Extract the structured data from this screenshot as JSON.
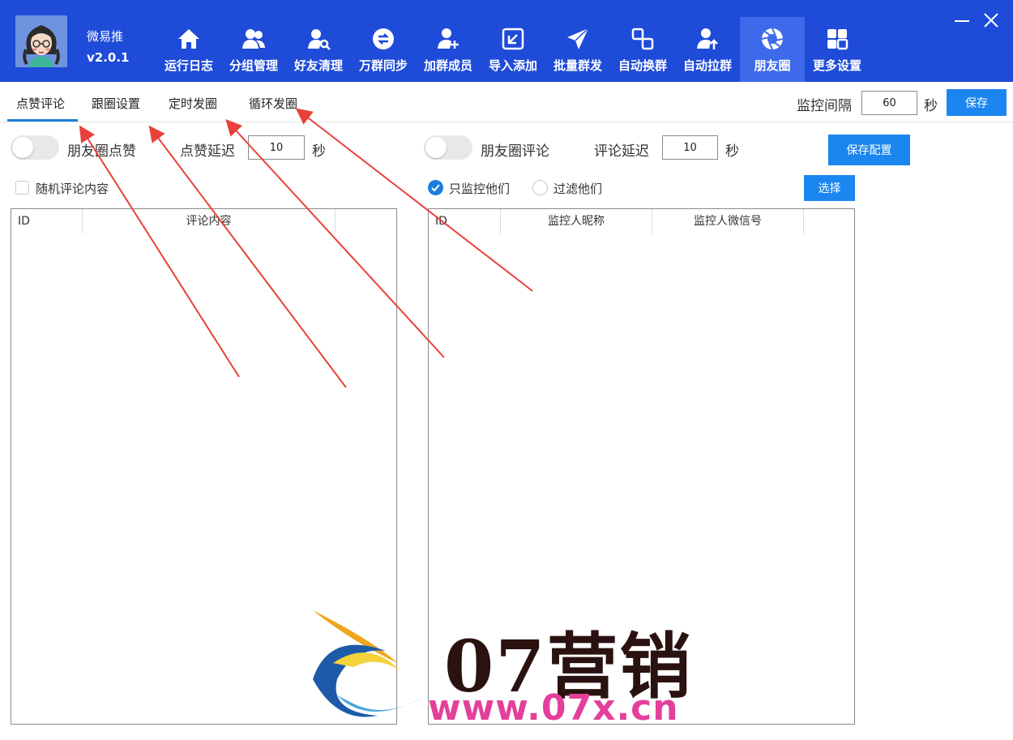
{
  "app": {
    "name": "微易推",
    "version": "v2.0.1"
  },
  "nav": [
    {
      "label": "运行日志",
      "icon": "home-icon"
    },
    {
      "label": "分组管理",
      "icon": "users-icon"
    },
    {
      "label": "好友清理",
      "icon": "user-search-icon"
    },
    {
      "label": "万群同步",
      "icon": "sync-icon"
    },
    {
      "label": "加群成员",
      "icon": "user-add-icon"
    },
    {
      "label": "导入添加",
      "icon": "import-icon"
    },
    {
      "label": "批量群发",
      "icon": "send-icon"
    },
    {
      "label": "自动换群",
      "icon": "switch-group-icon"
    },
    {
      "label": "自动拉群",
      "icon": "user-up-icon"
    },
    {
      "label": "朋友圈",
      "icon": "aperture-icon"
    },
    {
      "label": "更多设置",
      "icon": "grid-icon"
    }
  ],
  "tabs": [
    "点赞评论",
    "跟圈设置",
    "定时发圈",
    "循环发圈"
  ],
  "monitor": {
    "label": "监控间隔",
    "value": "60",
    "unit": "秒",
    "save_label": "保存"
  },
  "like": {
    "toggle_label": "朋友圈点赞",
    "delay_label": "点赞延迟",
    "delay_value": "10",
    "unit": "秒"
  },
  "comment": {
    "toggle_label": "朋友圈评论",
    "delay_label": "评论延迟",
    "delay_value": "10",
    "unit": "秒",
    "save_config_label": "保存配置"
  },
  "random_comment_label": "随机评论内容",
  "filter": {
    "only_monitor_label": "只监控他们",
    "filter_out_label": "过滤他们",
    "select_label": "选择"
  },
  "left_table": {
    "columns": [
      "ID",
      "评论内容"
    ]
  },
  "right_table": {
    "columns": [
      "ID",
      "监控人昵称",
      "监控人微信号"
    ]
  },
  "watermark": {
    "text": "07营销",
    "url": "www.07x.cn"
  },
  "colors": {
    "header": "#1f4bd9",
    "accent": "#1b86ef",
    "arrow": "#e8413a"
  }
}
